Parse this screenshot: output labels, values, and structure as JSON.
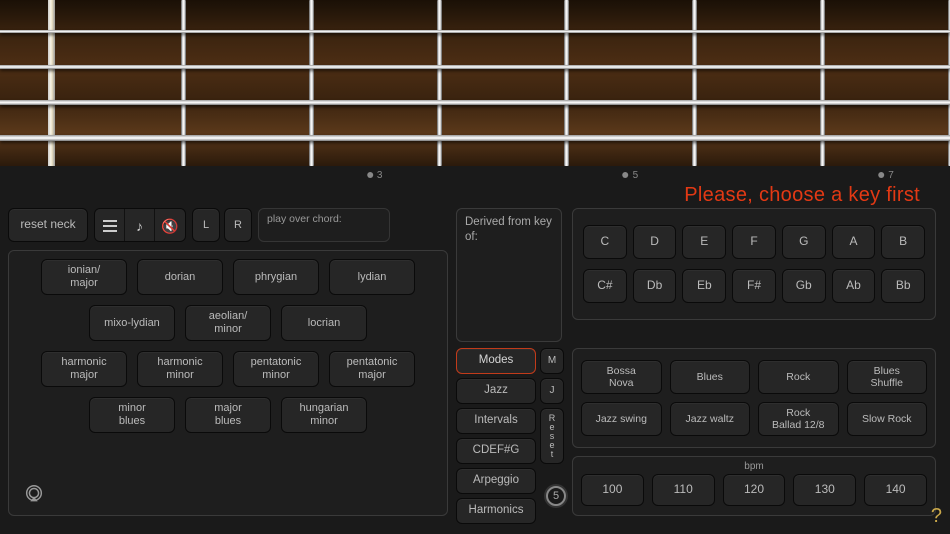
{
  "fretboard": {
    "fret_count": 7,
    "string_count": 4,
    "dot_markers": [
      {
        "fret": 3,
        "label": "3"
      },
      {
        "fret": 5,
        "label": "5"
      },
      {
        "fret": 7,
        "label": "7"
      }
    ]
  },
  "warning_text": "Please, choose a key first",
  "toolbar": {
    "reset_neck": "reset neck",
    "left": "L",
    "right": "R",
    "play_over_label": "play over chord:"
  },
  "scales": {
    "row1": [
      "ionian/\nmajor",
      "dorian",
      "phrygian",
      "lydian"
    ],
    "row2": [
      "mixo-lydian",
      "aeolian/\nminor",
      "locrian"
    ],
    "row3": [
      "harmonic\nmajor",
      "harmonic\nminor",
      "pentatonic\nminor",
      "pentatonic\nmajor"
    ],
    "row4": [
      "minor\nblues",
      "major\nblues",
      "hungarian\nminor"
    ]
  },
  "derived_label": "Derived from key of:",
  "categories": {
    "items": [
      "Modes",
      "Jazz",
      "Intervals",
      "CDEF#G",
      "Arpeggio",
      "Harmonics"
    ],
    "selected_index": 0,
    "aux": {
      "m": "M",
      "j": "J",
      "reset": "R\ne\ns\ne\nt"
    }
  },
  "keys": {
    "naturals": [
      "C",
      "D",
      "E",
      "F",
      "G",
      "A",
      "B"
    ],
    "accidentals": [
      "C#",
      "Db",
      "Eb",
      "F#",
      "Gb",
      "Ab",
      "Bb"
    ]
  },
  "styles": {
    "row1": [
      "Bossa\nNova",
      "Blues",
      "Rock",
      "Blues\nShuffle"
    ],
    "row2": [
      "Jazz swing",
      "Jazz waltz",
      "Rock\nBallad 12/8",
      "Slow Rock"
    ]
  },
  "bpm": {
    "label": "bpm",
    "values": [
      "100",
      "110",
      "120",
      "130",
      "140"
    ]
  },
  "circle_number": "5",
  "help": "?"
}
